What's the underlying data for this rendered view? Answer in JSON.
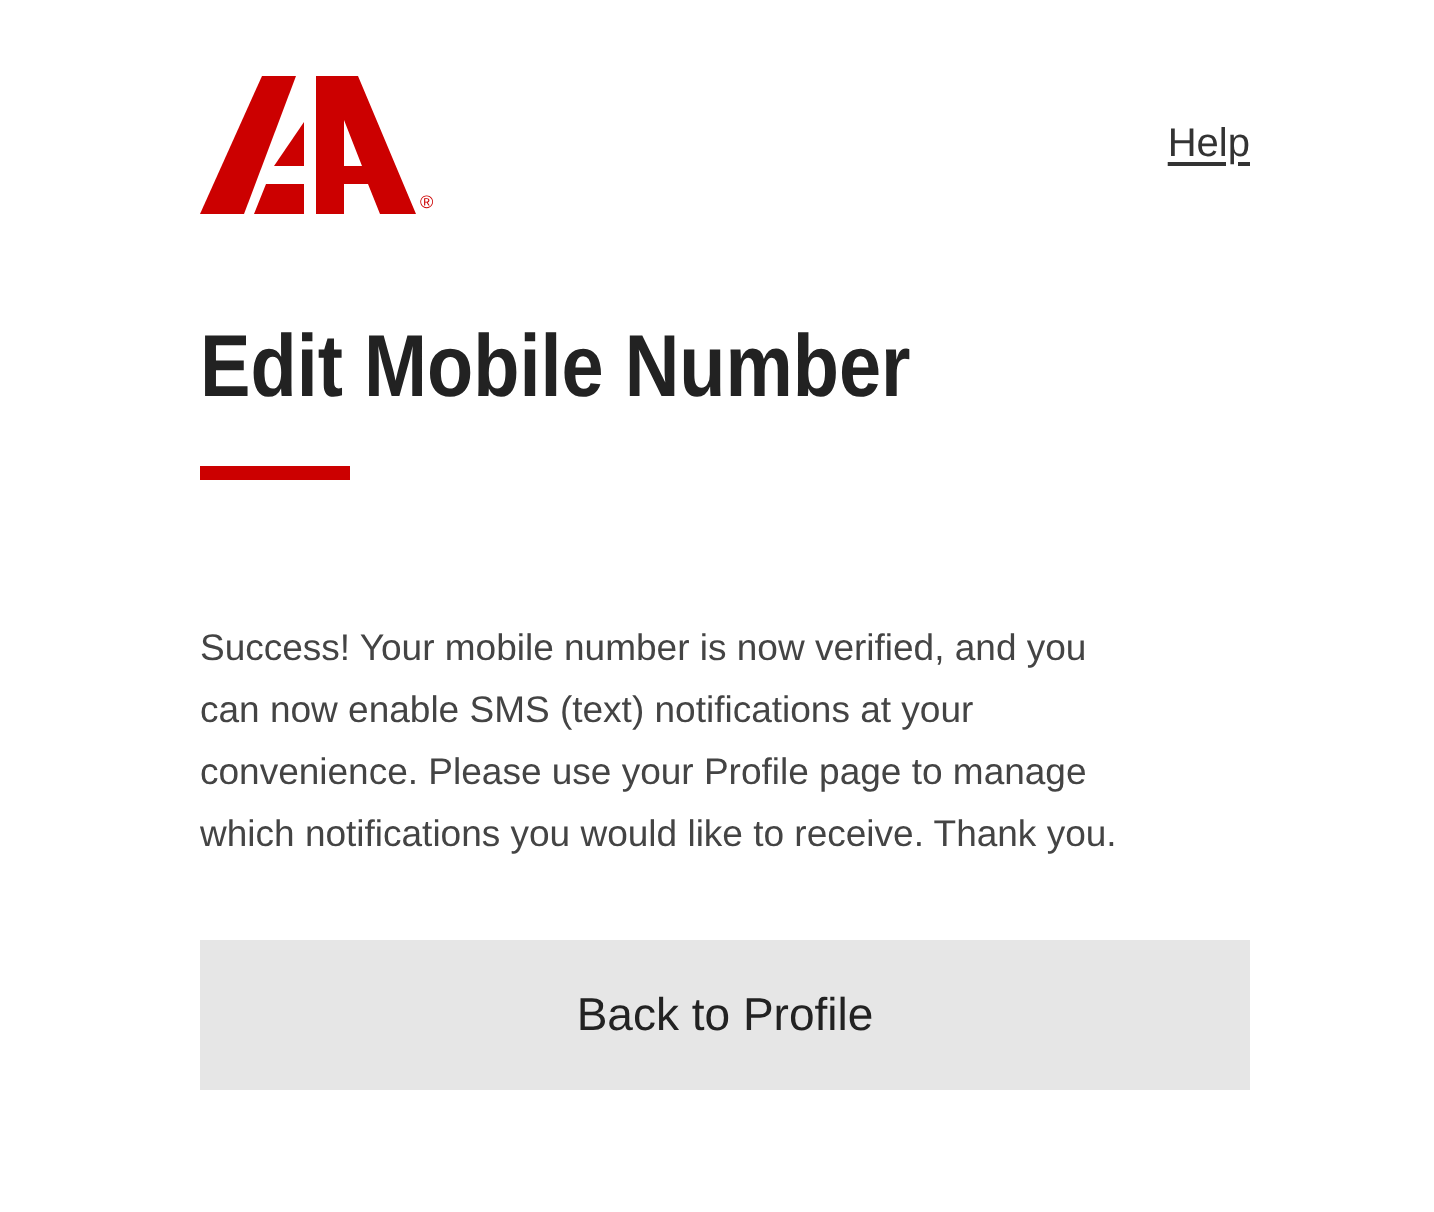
{
  "header": {
    "logo": {
      "registered_mark": "®"
    },
    "help_link": "Help"
  },
  "title": "Edit Mobile Number",
  "message": {
    "lines": [
      "Success! Your mobile number is now verified, and you",
      "can now enable SMS (text) notifications at your",
      "convenience. Please use your Profile page to manage",
      "which notifications you would like to receive. Thank you."
    ]
  },
  "buttons": [
    {
      "label": "Back to Profile",
      "kind": "secondary"
    }
  ]
}
